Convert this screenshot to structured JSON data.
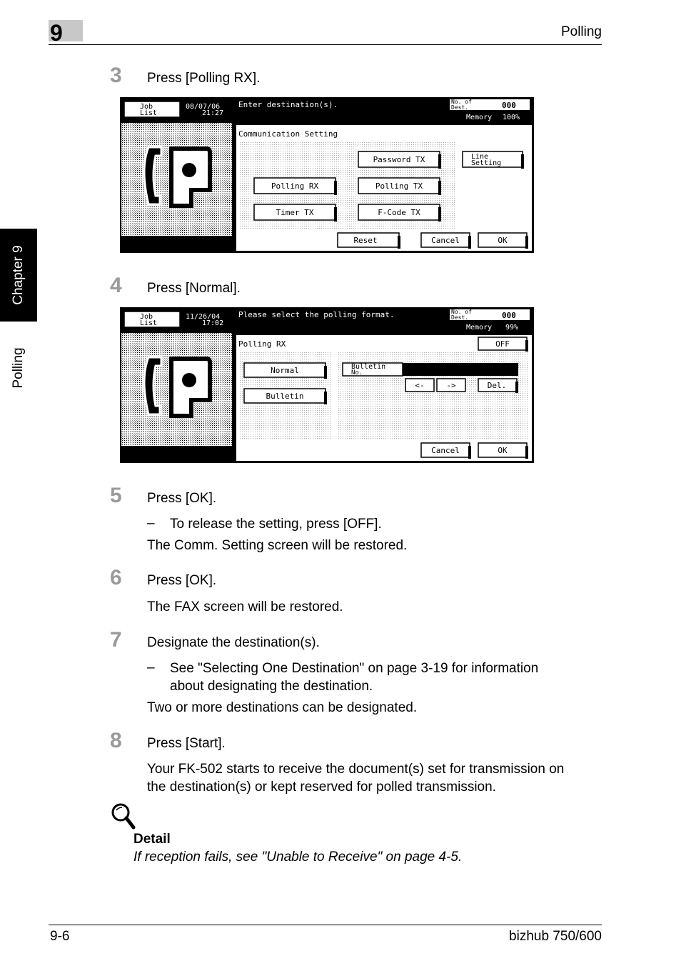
{
  "header": {
    "chapter_number": "9",
    "title": "Polling"
  },
  "side_tabs": {
    "chapter": "Chapter 9",
    "section": "Polling"
  },
  "steps": [
    {
      "num": "3",
      "text": "Press [Polling RX]."
    },
    {
      "num": "4",
      "text": "Press [Normal]."
    },
    {
      "num": "5",
      "text": "Press [OK].",
      "bullet": "To release the setting, press [OFF].",
      "note": "The Comm. Setting screen will be restored."
    },
    {
      "num": "6",
      "text": "Press [OK].",
      "note": "The FAX screen will be restored."
    },
    {
      "num": "7",
      "text": "Designate the destination(s).",
      "bullet_l1": "See \"Selecting One Destination\" on page 3-19 for information",
      "bullet_l2": "about designating the destination.",
      "note": "Two or more destinations can be designated."
    },
    {
      "num": "8",
      "text": "Press [Start].",
      "note_l1": "Your FK-502 starts to receive the document(s) set for transmission on",
      "note_l2": "the destination(s) or kept reserved for polled transmission."
    }
  ],
  "screen1": {
    "job_list": [
      "Job",
      "List"
    ],
    "date": "08/07/06",
    "time": "21:27",
    "message": "Enter destination(s).",
    "dest_label": [
      "No. of",
      "Dest."
    ],
    "dest_count": "000",
    "memory_label": "Memory",
    "memory_value": "100%",
    "panel_title": "Communication Setting",
    "buttons": {
      "password_tx": "Password TX",
      "line_setting": [
        "Line",
        "Setting"
      ],
      "polling_rx": "Polling RX",
      "polling_tx": "Polling TX",
      "timer_tx": "Timer TX",
      "fcode_tx": "F-Code TX",
      "reset": "Reset",
      "cancel": "Cancel",
      "ok": "OK"
    }
  },
  "screen2": {
    "job_list": [
      "Job",
      "List"
    ],
    "date": "11/26/04",
    "time": "17:02",
    "message": "Please select the polling format.",
    "dest_label": [
      "No. of",
      "Dest."
    ],
    "dest_count": "000",
    "memory_label": "Memory",
    "memory_value": "99%",
    "panel_title": "Polling RX",
    "buttons": {
      "off": "OFF",
      "normal": "Normal",
      "bulletin": "Bulletin",
      "bulletin_no": [
        "Bulletin",
        "No."
      ],
      "left_arrow": "<-",
      "right_arrow": "->",
      "del": "Del.",
      "cancel": "Cancel",
      "ok": "OK"
    }
  },
  "detail": {
    "title": "Detail",
    "text": "If reception fails, see \"Unable to Receive\" on page 4-5."
  },
  "footer": {
    "page": "9-6",
    "product": "bizhub 750/600"
  }
}
